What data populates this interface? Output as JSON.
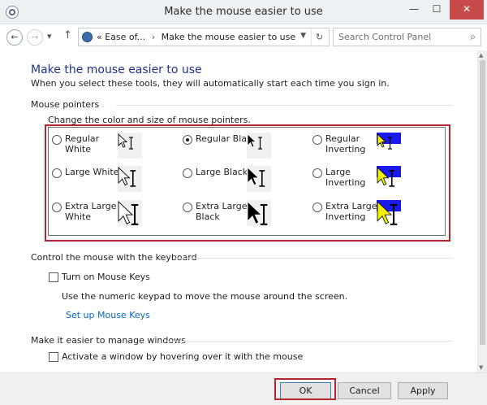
{
  "window": {
    "title": "Make the mouse easier to use",
    "controls": {
      "minimize": "—",
      "maximize": "☐",
      "close": "✕"
    }
  },
  "navbar": {
    "back_icon": "←",
    "forward_icon": "→",
    "recent_icon": "▾",
    "up_icon": "↑",
    "breadcrumb_prefix": "«",
    "breadcrumbs": [
      "Ease of...",
      "Make the mouse easier to use"
    ],
    "breadcrumb_separator": "›",
    "dropdown_icon": "▼",
    "refresh_icon": "↻",
    "search_placeholder": "Search Control Panel",
    "search_icon": "⌕"
  },
  "page": {
    "heading": "Make the mouse easier to use",
    "subheading": "When you select these tools, they will automatically start each time you sign in."
  },
  "mouse_pointers": {
    "section_title": "Mouse pointers",
    "instruction": "Change the color and size of mouse pointers.",
    "options": [
      {
        "label": "Regular\nWhite",
        "style": "white",
        "size": "regular",
        "checked": false
      },
      {
        "label": "Regular Black",
        "style": "black",
        "size": "regular",
        "checked": true
      },
      {
        "label": "Regular\nInverting",
        "style": "inverting",
        "size": "regular",
        "checked": false
      },
      {
        "label": "Large White",
        "style": "white",
        "size": "large",
        "checked": false
      },
      {
        "label": "Large Black",
        "style": "black",
        "size": "large",
        "checked": false
      },
      {
        "label": "Large\nInverting",
        "style": "inverting",
        "size": "large",
        "checked": false
      },
      {
        "label": "Extra Large\nWhite",
        "style": "white",
        "size": "extra-large",
        "checked": false
      },
      {
        "label": "Extra Large\nBlack",
        "style": "black",
        "size": "extra-large",
        "checked": false
      },
      {
        "label": "Extra Large\nInverting",
        "style": "inverting",
        "size": "extra-large",
        "checked": false
      }
    ]
  },
  "keyboard": {
    "section_title": "Control the mouse with the keyboard",
    "mouse_keys_label": "Turn on Mouse Keys",
    "mouse_keys_checked": false,
    "description": "Use the numeric keypad to move the mouse around the screen.",
    "setup_link": "Set up Mouse Keys"
  },
  "windows": {
    "section_title": "Make it easier to manage windows",
    "hover_label": "Activate a window by hovering over it with the mouse",
    "hover_checked": false
  },
  "footer": {
    "ok_label": "OK",
    "cancel_label": "Cancel",
    "apply_label": "Apply"
  },
  "colors": {
    "heading": "#1e3287",
    "link": "#0066cc",
    "highlight": "#b3262c",
    "inverting_blue": "#1a1aee",
    "inverting_yellow": "#f5f000"
  }
}
